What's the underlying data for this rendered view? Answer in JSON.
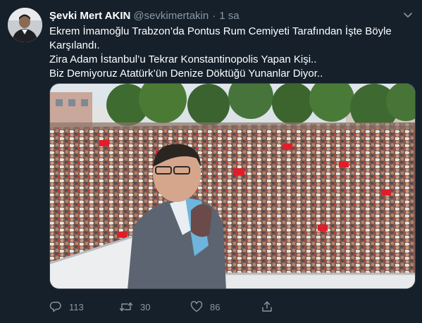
{
  "user": {
    "display_name": "Şevki Mert AKIN",
    "handle": "@sevkimertakin",
    "separator": "·",
    "time": "1 sa"
  },
  "tweet": {
    "lines": [
      "Ekrem İmamoğlu Trabzon’da Pontus Rum Cemiyeti Tarafından İşte Böyle Karşılandı.",
      "Zira Adam İstanbul’u Tekrar Konstantinopolis Yapan Kişi..",
      "Biz Demiyoruz Atatürk’ün Denize Döktüğü Yunanlar Diyor.."
    ]
  },
  "actions": {
    "reply_count": "113",
    "retweet_count": "30",
    "like_count": "86"
  },
  "icons": {
    "avatar": "profile-photo",
    "caret": "chevron-down-icon",
    "reply": "reply-icon",
    "retweet": "retweet-icon",
    "like": "heart-icon",
    "share": "share-icon"
  },
  "colors": {
    "background": "#15202b",
    "text_primary": "#ffffff",
    "text_secondary": "#8899a6",
    "border": "#38444d"
  }
}
